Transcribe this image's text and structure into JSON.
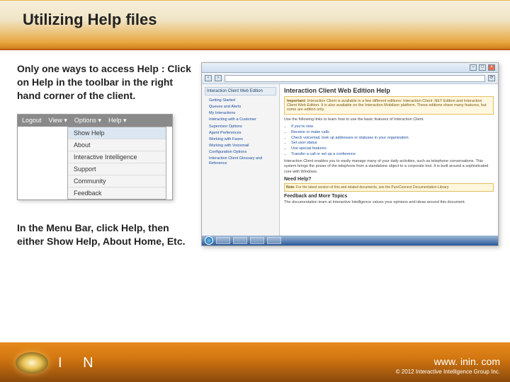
{
  "title": "Utilizing Help files",
  "intro": "Only one ways to access Help : Click on Help in the toolbar in the right hand corner of the client.",
  "outro": "In the Menu Bar, click Help, then either Show Help, About Home, Etc.",
  "menu_shot": {
    "menubar": [
      "Logout",
      "View ▾",
      "Options ▾",
      "Help ▾"
    ],
    "help_items": [
      "Show Help",
      "About",
      "Interactive Intelligence",
      "Support",
      "Community",
      "Feedback"
    ]
  },
  "browser": {
    "side_header": "Interaction Client Web Edition",
    "toc": [
      "Getting Started",
      "Queues and Alerts",
      "My Interactions",
      "Interacting with a Customer",
      "Supervisor Options",
      "Agent Preferences",
      "Working with Faxes",
      "Working with Voicemail",
      "Configuration Options",
      "Interaction Client Glossary and Reference"
    ],
    "heading": "Interaction Client Web Edition Help",
    "important_label": "Important:",
    "important_text": "Interaction Client is available in a few different editions: Interaction Client .NET Edition and Interaction Client Web Edition. It is also available on the Interaction Mobilizer platform. These editions share many features, but some are edition only.",
    "intro_line": "Use the following links to learn how to use the basic features of Interaction Client.",
    "links": [
      "If you're new",
      "Receive or make calls",
      "Check voicemail, look up addresses or statuses in your organization",
      "Set user status",
      "Use special features",
      "Transfer a call or set up a conference"
    ],
    "para2": "Interaction Client enables you to easily manage many of your daily activities, such as telephone conversations. This system brings the power of the telephone from a standalone object to a corporate tool. It is built around a sophisticated core with Windows.",
    "need_help": "Need Help?",
    "note_label": "Note:",
    "note_text": "For the latest version of this and related documents, see the PureConnect Documentation Library.",
    "feedback_heading": "Feedback and More Topics",
    "feedback_text": "The documentation team at Interactive Intelligence values your opinions and ideas around this document."
  },
  "footer": {
    "logo_letters": "I N",
    "url": "www. inin. com",
    "copyright": "© 2012 Interactive Intelligence Group Inc."
  }
}
